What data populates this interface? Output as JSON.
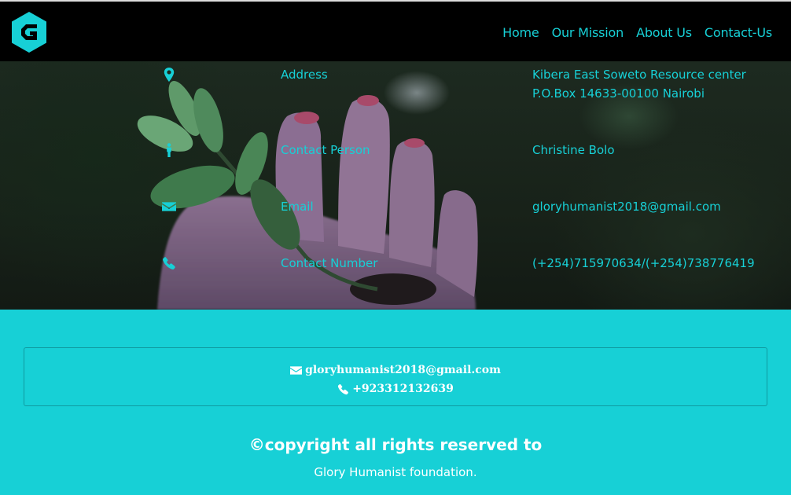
{
  "nav": {
    "items": [
      {
        "label": "Home"
      },
      {
        "label": "Our Mission"
      },
      {
        "label": "About Us"
      },
      {
        "label": "Contact-Us"
      }
    ]
  },
  "contacts": [
    {
      "icon": "map-marker-icon",
      "label": "Address",
      "value_line1": "Kibera East Soweto Resource center",
      "value_line2": "P.O.Box 14633-00100 Nairobi"
    },
    {
      "icon": "person-icon",
      "label": "Contact Person",
      "value_line1": "Christine Bolo",
      "value_line2": ""
    },
    {
      "icon": "envelope-icon",
      "label": "Email",
      "value_line1": "gloryhumanist2018@gmail.com",
      "value_line2": ""
    },
    {
      "icon": "phone-icon",
      "label": "Contact Number",
      "value_line1": "(+254)715970634/(+254)738776419",
      "value_line2": ""
    }
  ],
  "footer": {
    "email": "gloryhumanist2018@gmail.com",
    "phone": "+923312132639",
    "copyright": "©copyright all rights reserved to",
    "foundation": "Glory Humanist foundation."
  },
  "colors": {
    "accent": "#17d0d6",
    "navbar": "#000000",
    "hero_dark": "#1d2a20"
  }
}
